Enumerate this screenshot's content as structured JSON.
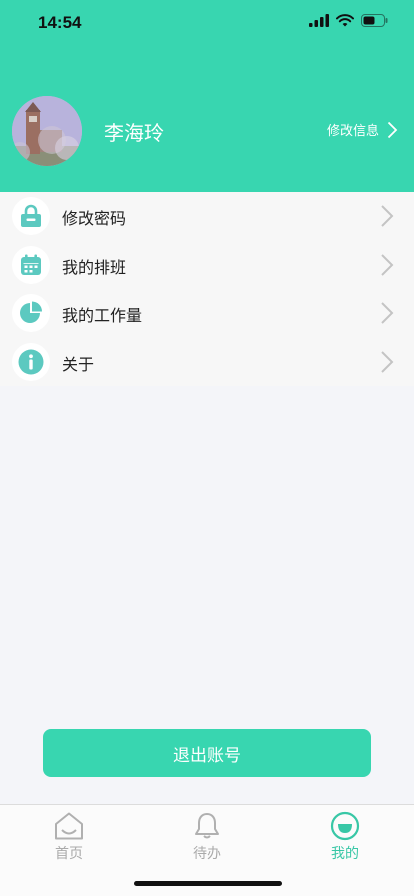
{
  "status_bar": {
    "time": "14:54"
  },
  "profile": {
    "name": "李海玲",
    "edit_label": "修改信息"
  },
  "menu": [
    {
      "label": "修改密码",
      "icon": "lock-icon"
    },
    {
      "label": "我的排班",
      "icon": "calendar-icon"
    },
    {
      "label": "我的工作量",
      "icon": "pie-chart-icon"
    },
    {
      "label": "关于",
      "icon": "info-icon"
    }
  ],
  "logout_label": "退出账号",
  "tabs": [
    {
      "label": "首页",
      "icon": "home-icon",
      "active": false
    },
    {
      "label": "待办",
      "icon": "bell-icon",
      "active": false
    },
    {
      "label": "我的",
      "icon": "smile-icon",
      "active": true
    }
  ],
  "colors": {
    "accent": "#38d6b0",
    "icon_teal": "#5cc9c0",
    "background": "#f4f5f9"
  }
}
